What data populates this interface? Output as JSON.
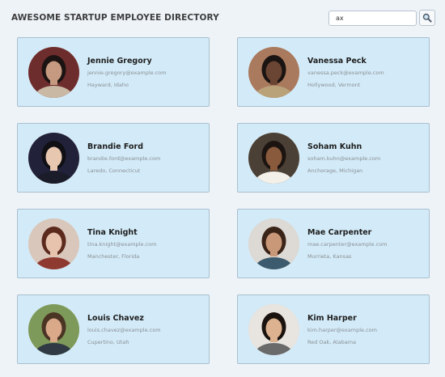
{
  "header": {
    "title": "AWESOME STARTUP EMPLOYEE DIRECTORY"
  },
  "search": {
    "value": "ax",
    "icon": "magnifying-glass-icon"
  },
  "employees": [
    {
      "name": "Jennie Gregory",
      "email": "jennie.gregory@example.com",
      "location": "Hayward, Idaho",
      "bg": "#6e2d2d",
      "skin": "#c69a80",
      "hair": "#1c1413",
      "shirt": "#c9b8a4"
    },
    {
      "name": "Vanessa Peck",
      "email": "vanessa.peck@example.com",
      "location": "Hollywood, Vermont",
      "bg": "#a97a5e",
      "skin": "#6b4533",
      "hair": "#1a1412",
      "shirt": "#b9a27a"
    },
    {
      "name": "Brandie Ford",
      "email": "brandie.ford@example.com",
      "location": "Laredo, Connecticut",
      "bg": "#21213a",
      "skin": "#e8c7b0",
      "hair": "#0f0f14",
      "shirt": "#1b1c2a"
    },
    {
      "name": "Soham Kuhn",
      "email": "soham.kuhn@example.com",
      "location": "Anchorage, Michigan",
      "bg": "#4b4036",
      "skin": "#8a5a3d",
      "hair": "#1b1410",
      "shirt": "#f3f0ea"
    },
    {
      "name": "Tina Knight",
      "email": "tina.knight@example.com",
      "location": "Manchester, Florida",
      "bg": "#d9c7bc",
      "skin": "#e7c3ae",
      "hair": "#5b2a1d",
      "shirt": "#8e3a30"
    },
    {
      "name": "Mae Carpenter",
      "email": "mae.carpenter@example.com",
      "location": "Murrieta, Kansas",
      "bg": "#ddd9d4",
      "skin": "#c89878",
      "hair": "#3a2418",
      "shirt": "#3d5b6e"
    },
    {
      "name": "Louis Chavez",
      "email": "louis.chavez@example.com",
      "location": "Cupertino, Utah",
      "bg": "#7e9a5a",
      "skin": "#d9a98a",
      "hair": "#4a3424",
      "shirt": "#2f3a44"
    },
    {
      "name": "Kim Harper",
      "email": "kim.harper@example.com",
      "location": "Red Oak, Alabama",
      "bg": "#e8e4e0",
      "skin": "#dcb290",
      "hair": "#1a120e",
      "shirt": "#6a6a6a"
    }
  ]
}
